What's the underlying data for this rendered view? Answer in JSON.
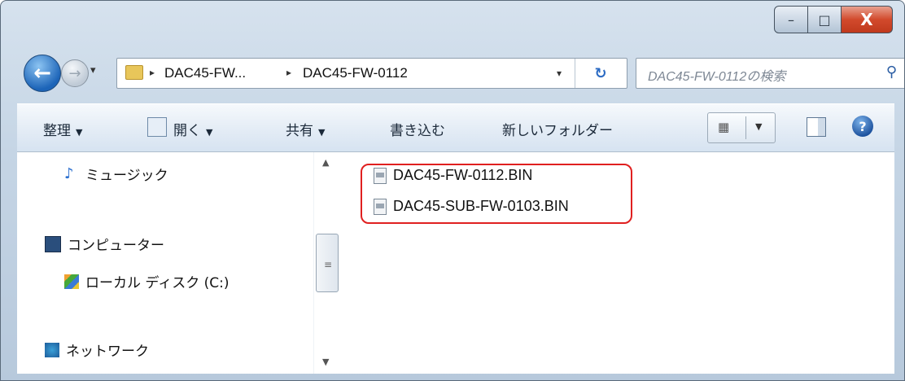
{
  "caption": {
    "min_glyph": "–",
    "max_glyph": "□",
    "close_glyph": "X"
  },
  "nav": {
    "back_glyph": "←",
    "forward_glyph": "→",
    "dropdown_glyph": "▾",
    "breadcrumb": [
      "DAC45-FW...",
      "DAC45-FW-0112"
    ],
    "breadcrumb_sep": "▸",
    "refresh_glyph": "↻",
    "search_placeholder": "DAC45-FW-0112の検索",
    "search_icon": "search-icon"
  },
  "toolbar": {
    "organize": "整理",
    "open": "開く",
    "share": "共有",
    "burn": "書き込む",
    "new_folder": "新しいフォルダー",
    "dd": "▼"
  },
  "sidebar": {
    "items": [
      {
        "label": "ミュージック",
        "icon": "music-icon"
      },
      {
        "label": "コンピューター",
        "icon": "computer-icon"
      },
      {
        "label": "ローカル ディスク (C:)",
        "icon": "disk-icon"
      },
      {
        "label": "ネットワーク",
        "icon": "network-icon"
      }
    ]
  },
  "files": [
    {
      "name": "DAC45-FW-0112.BIN"
    },
    {
      "name": "DAC45-SUB-FW-0103.BIN"
    }
  ],
  "colors": {
    "highlight": "#e02020",
    "accent": "#1c64b8"
  }
}
